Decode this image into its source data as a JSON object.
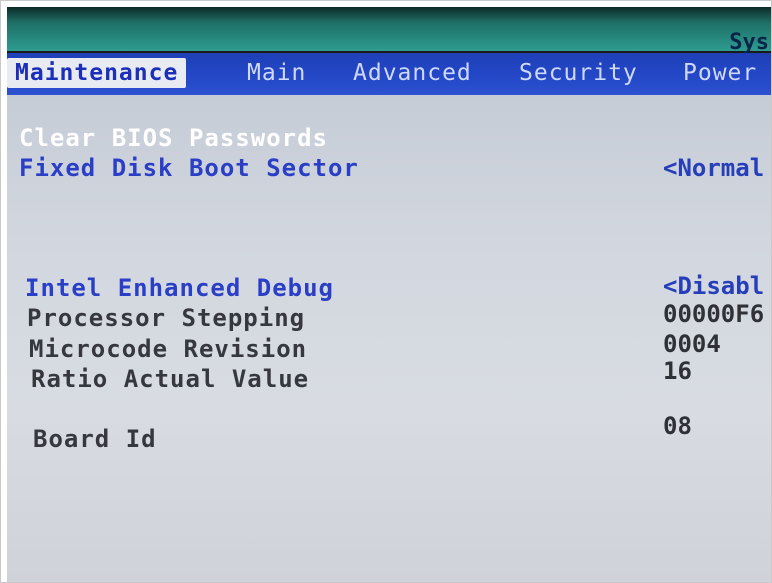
{
  "header": {
    "system_label": "Sys"
  },
  "menu": {
    "tabs": [
      {
        "label": "Maintenance",
        "active": true
      },
      {
        "label": "Main",
        "active": false
      },
      {
        "label": "Advanced",
        "active": false
      },
      {
        "label": "Security",
        "active": false
      },
      {
        "label": "Power",
        "active": false
      }
    ]
  },
  "items": [
    {
      "label": "Clear BIOS Passwords",
      "value": "",
      "selected": true
    },
    {
      "label": "Fixed Disk Boot Sector",
      "value": "<Normal",
      "selected": false
    },
    {
      "label": "Intel Enhanced Debug",
      "value": "<Disabl",
      "selected": false
    },
    {
      "label": "Processor Stepping",
      "value": "00000F6",
      "selected": false
    },
    {
      "label": "Microcode Revision",
      "value": "0004",
      "selected": false
    },
    {
      "label": "Ratio Actual Value",
      "value": "16",
      "selected": false
    },
    {
      "label": "Board Id",
      "value": "08",
      "selected": false
    }
  ],
  "colors": {
    "menu_bar": "#2448c8",
    "panel": "#d2d7df",
    "configurable_item": "#2a3fc6",
    "info_item": "#36383e",
    "selected_item": "#ffffff",
    "header": "#2d9c91"
  }
}
